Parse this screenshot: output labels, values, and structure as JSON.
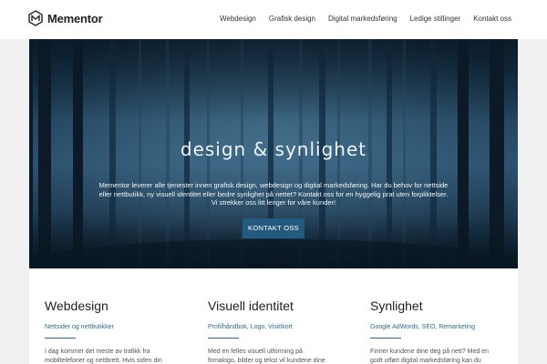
{
  "brand": {
    "name": "Mementor"
  },
  "nav": {
    "items": [
      {
        "label": "Webdesign"
      },
      {
        "label": "Grafisk design"
      },
      {
        "label": "Digital markedsføring"
      },
      {
        "label": "Ledige stillinger"
      },
      {
        "label": "Kontakt oss"
      }
    ]
  },
  "hero": {
    "title": "design & synlighet",
    "lines": [
      "Mementor leverer alle tjenester innen grafisk design, webdesign og digital markedsføring. Har du behov for nettside",
      "eller nettbutikk, ny visuell identitet eller bedre synlighet på nettet? Kontakt oss for en hyggelig prat uten forpliktelser.",
      "Vi strekker oss litt lenger for våre kunder!"
    ],
    "cta_label": "KONTAKT OSS"
  },
  "cards": [
    {
      "title": "Webdesign",
      "subtitle": "Nettsider og nettbutikker",
      "body": "I dag kommer det meste av trafikk fra mobiltelefoner og nettbrett. Hvis siden din"
    },
    {
      "title": "Visuell identitet",
      "subtitle": "Profilhåndbok, Logo, Visittkort",
      "body": "Med en felles visuell utforming på firmalogo, bilder og tekst vil kundene dine lettere legge"
    },
    {
      "title": "Synlighet",
      "subtitle": "Google AdWords, SEO, Remarketing",
      "body": "Finner kundene dine deg på nett? Med en godt utført digital markedsføring kan du"
    }
  ],
  "colors": {
    "accent": "#2d6d94",
    "cta_bg": "#235a7d",
    "hero_dark": "#0e2233"
  }
}
